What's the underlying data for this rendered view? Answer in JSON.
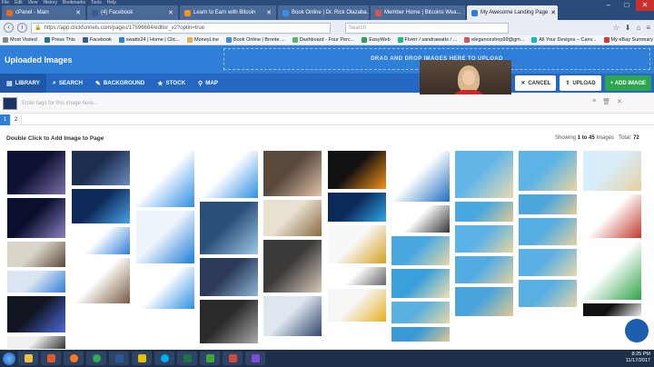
{
  "browser": {
    "menus": [
      "File",
      "Edit",
      "View",
      "History",
      "Bookmarks",
      "Tools",
      "Help"
    ],
    "tabs": [
      {
        "label": "cPanel - Main",
        "color": "#e86c1f",
        "active": false
      },
      {
        "label": "(4) Facebook",
        "color": "#3b5998",
        "active": false
      },
      {
        "label": "Learn to Earn with Bitcoin",
        "color": "#f7931a",
        "active": false
      },
      {
        "label": "Book Online | Dr. Rick Olazaba...",
        "color": "#3a8ee6",
        "active": false
      },
      {
        "label": "Member Home | Bitcoins Wea...",
        "color": "#d9534f",
        "active": false
      },
      {
        "label": "My Awesome Landing Page",
        "color": "#2f7fd8",
        "active": true
      }
    ],
    "url": "https://app.clickfunnels.com/pages/17596684/editor_v2?optin=true",
    "search_placeholder": "Search",
    "bookmarks": [
      {
        "label": "Most Visited",
        "color": "#888888"
      },
      {
        "label": "Press This",
        "color": "#21759b"
      },
      {
        "label": "Facebook",
        "color": "#3b5998"
      },
      {
        "label": "swatts24 | Home | Clic...",
        "color": "#2f7fd8"
      },
      {
        "label": "MoneyLine",
        "color": "#f0ad4e"
      },
      {
        "label": "Book Online | Bronte ...",
        "color": "#3a8ee6"
      },
      {
        "label": "Dashboard - Four Perc...",
        "color": "#5cb85c"
      },
      {
        "label": "EasyWeb",
        "color": "#2da44e"
      },
      {
        "label": "Fiverr / sandrawatts / ...",
        "color": "#1dbf73"
      },
      {
        "label": "eleganceshop99@gm...",
        "color": "#d9534f"
      },
      {
        "label": "All Your Designs – Canv...",
        "color": "#00c4cc"
      },
      {
        "label": "My eBay Summary",
        "color": "#e53238"
      }
    ]
  },
  "app": {
    "title": "Uploaded Images",
    "drop_text": "DRAG AND DROP IMAGES HERE TO UPLOAD",
    "tabs": [
      {
        "label": "LIBRARY",
        "icon": "library-icon",
        "glyph": "▤",
        "active": true
      },
      {
        "label": "SEARCH",
        "icon": "search-icon",
        "glyph": "⌕",
        "active": false
      },
      {
        "label": "BACKGROUND",
        "icon": "brush-icon",
        "glyph": "✎",
        "active": false
      },
      {
        "label": "STOCK",
        "icon": "star-icon",
        "glyph": "★",
        "active": false
      },
      {
        "label": "MAP",
        "icon": "map-pin-icon",
        "glyph": "⚲",
        "active": false
      }
    ],
    "buttons": {
      "cancel": "CANCEL",
      "upload": "UPLOAD",
      "add": "+ ADD IMAGE"
    },
    "tag_placeholder": "Enter tags for this image here...",
    "pages": [
      "1",
      "2"
    ],
    "hint": "Double Click to Add Image to Page",
    "showing_prefix": "Showing",
    "showing_range": "1 to 45",
    "showing_of": "Images",
    "total_label": "Total:",
    "total_value": "72"
  },
  "taskbar": {
    "time": "8:25 PM",
    "date": "11/17/2017"
  },
  "colors": {
    "header": "#2f7fd8",
    "toolbar": "#2568c4",
    "add_button": "#2da44e"
  }
}
